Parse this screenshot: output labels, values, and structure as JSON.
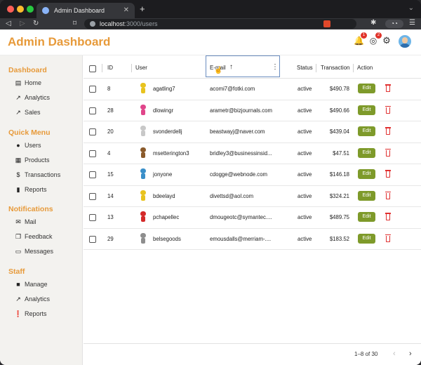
{
  "browser": {
    "tab_title": "Admin Dashboard",
    "url_host": "localhost",
    "url_path": ":3000/users",
    "ext_glasses": "◔◔"
  },
  "header": {
    "title": "Admin Dashboard",
    "notif_badge": "1",
    "globe_badge": "2"
  },
  "sidebar": {
    "sections": [
      {
        "title": "Dashboard",
        "items": [
          {
            "label": "Home",
            "icon": "home-icon"
          },
          {
            "label": "Analytics",
            "icon": "analytics-icon"
          },
          {
            "label": "Sales",
            "icon": "sales-icon"
          }
        ]
      },
      {
        "title": "Quick Menu",
        "items": [
          {
            "label": "Users",
            "icon": "users-icon"
          },
          {
            "label": "Products",
            "icon": "products-icon"
          },
          {
            "label": "Transactions",
            "icon": "dollar-icon"
          },
          {
            "label": "Reports",
            "icon": "reports-icon"
          }
        ]
      },
      {
        "title": "Notifications",
        "items": [
          {
            "label": "Mail",
            "icon": "mail-icon"
          },
          {
            "label": "Feedback",
            "icon": "feedback-icon"
          },
          {
            "label": "Messages",
            "icon": "messages-icon"
          }
        ]
      },
      {
        "title": "Staff",
        "items": [
          {
            "label": "Manage",
            "icon": "briefcase-icon"
          },
          {
            "label": "Analytics",
            "icon": "analytics-icon"
          },
          {
            "label": "Reports",
            "icon": "report-alert-icon"
          }
        ]
      }
    ]
  },
  "table": {
    "columns": {
      "id": "ID",
      "user": "User",
      "email": "E-mail",
      "status": "Status",
      "transaction": "Transaction",
      "action": "Action"
    },
    "edit_label": "Edit",
    "rows": [
      {
        "id": "8",
        "user": "agatling7",
        "email": "acomi7@fotki.com",
        "status": "active",
        "transaction": "$490.78",
        "avatar_color": "#e8c31f"
      },
      {
        "id": "28",
        "user": "dlowingr",
        "email": "arametr@bizjournals.com",
        "status": "active",
        "transaction": "$490.66",
        "avatar_color": "#e0458a"
      },
      {
        "id": "20",
        "user": "svonderdellj",
        "email": "beastwayj@naver.com",
        "status": "active",
        "transaction": "$439.04",
        "avatar_color": "#c8c8c8"
      },
      {
        "id": "4",
        "user": "msetterington3",
        "email": "bridley3@businessinsid...",
        "status": "active",
        "transaction": "$47.51",
        "avatar_color": "#8a5a2b"
      },
      {
        "id": "15",
        "user": "jonyone",
        "email": "cdogge@webnode.com",
        "status": "active",
        "transaction": "$146.18",
        "avatar_color": "#3a8fc9"
      },
      {
        "id": "14",
        "user": "bdeelayd",
        "email": "divettsd@aol.com",
        "status": "active",
        "transaction": "$324.21",
        "avatar_color": "#e8c31f"
      },
      {
        "id": "13",
        "user": "pchapellec",
        "email": "dmougeotc@symantec....",
        "status": "active",
        "transaction": "$489.75",
        "avatar_color": "#d42a2a"
      },
      {
        "id": "29",
        "user": "belsegoods",
        "email": "emousdalls@merriam-....",
        "status": "active",
        "transaction": "$183.52",
        "avatar_color": "#8e8e8e"
      }
    ]
  },
  "pagination": {
    "label": "1–8 of 30"
  }
}
